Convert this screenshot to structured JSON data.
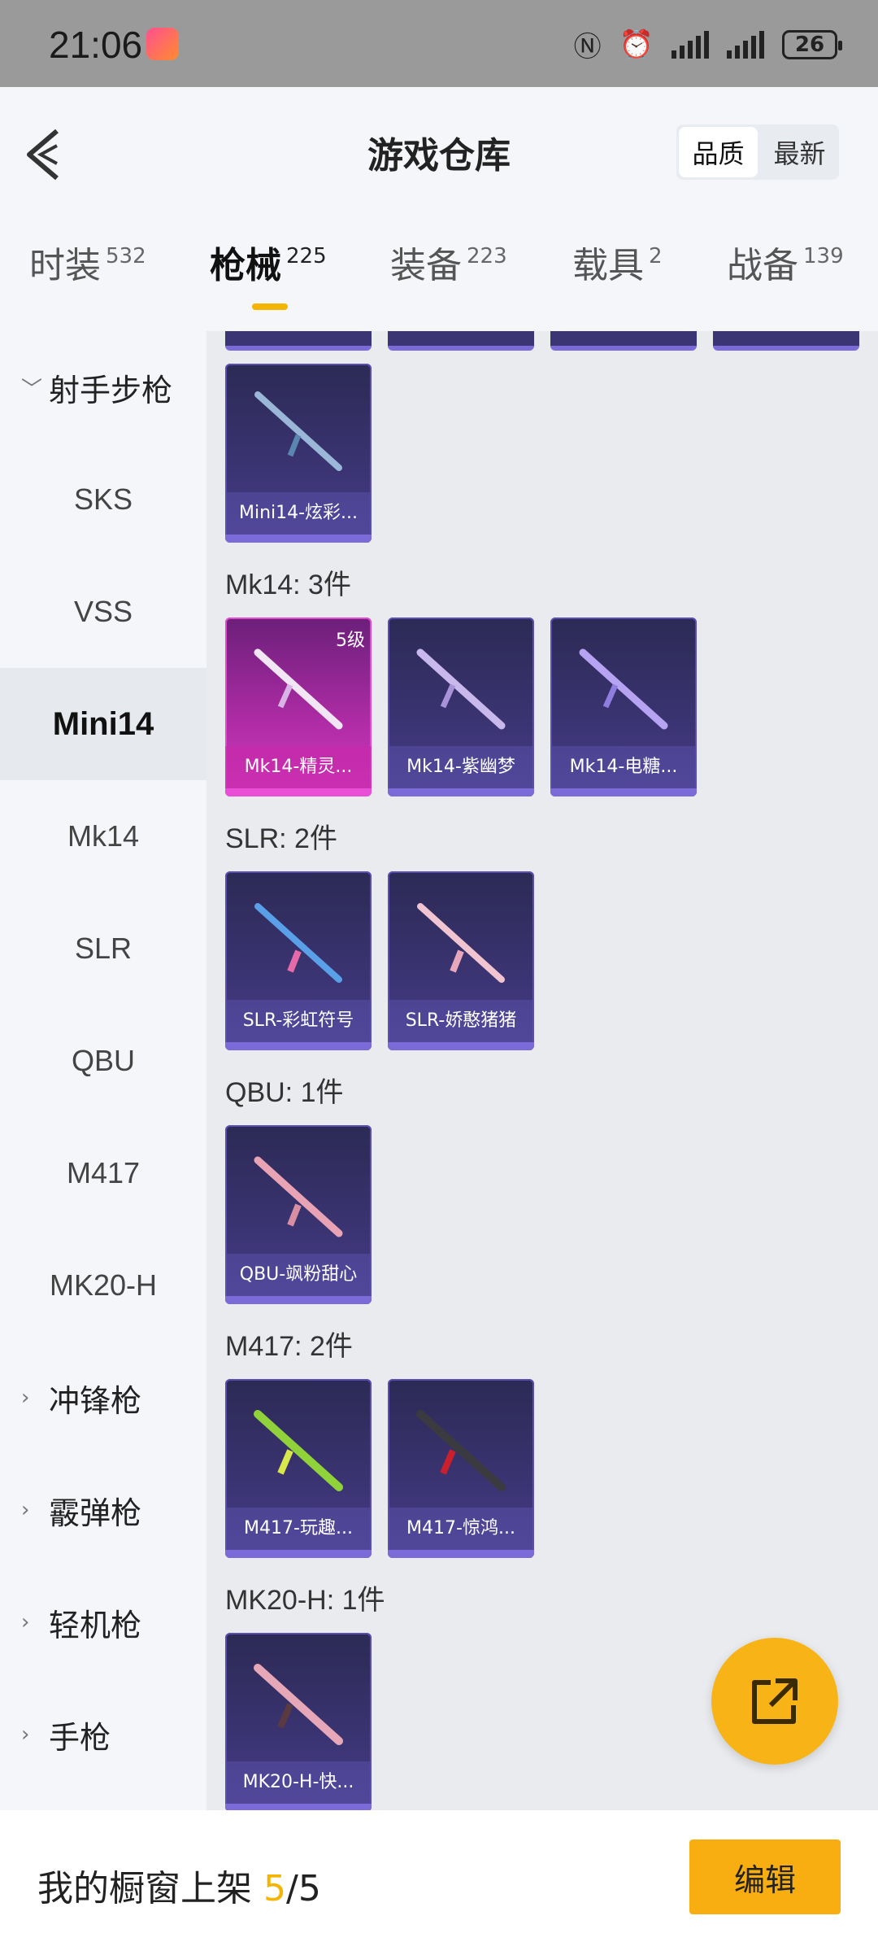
{
  "status": {
    "time": "21:06",
    "battery": "26"
  },
  "header": {
    "title": "游戏仓库",
    "sort": [
      "品质",
      "最新"
    ]
  },
  "tabs": [
    {
      "label": "时装",
      "count": "532"
    },
    {
      "label": "枪械",
      "count": "225"
    },
    {
      "label": "装备",
      "count": "223"
    },
    {
      "label": "载具",
      "count": "2"
    },
    {
      "label": "战备",
      "count": "139"
    }
  ],
  "sidebar": {
    "category_open": "射手步枪",
    "items": [
      "SKS",
      "VSS",
      "Mini14",
      "Mk14",
      "SLR",
      "QBU",
      "M417",
      "MK20-H"
    ],
    "categories": [
      "冲锋枪",
      "霰弹枪",
      "轻机枪",
      "手枪"
    ]
  },
  "sections": [
    {
      "title": "",
      "items": [
        {
          "name": "Mini14-炫彩...",
          "level": ""
        }
      ]
    },
    {
      "title": "Mk14: 3件",
      "items": [
        {
          "name": "Mk14-精灵...",
          "level": "5级"
        },
        {
          "name": "Mk14-紫幽梦",
          "level": ""
        },
        {
          "name": "Mk14-电糖...",
          "level": ""
        }
      ]
    },
    {
      "title": "SLR: 2件",
      "items": [
        {
          "name": "SLR-彩虹符号",
          "level": ""
        },
        {
          "name": "SLR-娇憨猪猪",
          "level": ""
        }
      ]
    },
    {
      "title": "QBU: 1件",
      "items": [
        {
          "name": "QBU-飒粉甜心",
          "level": ""
        }
      ]
    },
    {
      "title": "M417: 2件",
      "items": [
        {
          "name": "M417-玩趣...",
          "level": ""
        },
        {
          "name": "M417-惊鸿...",
          "level": ""
        }
      ]
    },
    {
      "title": "MK20-H: 1件",
      "items": [
        {
          "name": "MK20-H-快...",
          "level": ""
        }
      ]
    }
  ],
  "bottom": {
    "label": "我的橱窗上架",
    "current": "5",
    "sep": "/",
    "total": "5",
    "edit": "编辑"
  },
  "colors": {
    "accent": "#f8ae10",
    "card": "#3b3473",
    "card_rare": "#b02ca6"
  }
}
